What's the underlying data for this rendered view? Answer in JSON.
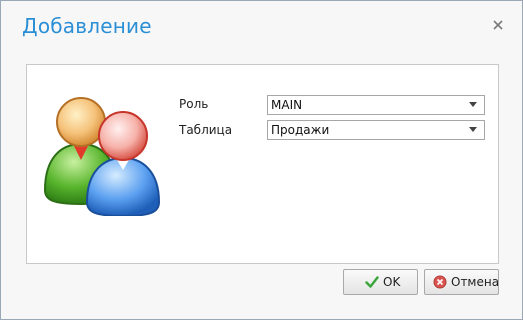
{
  "dialog": {
    "title": "Добавление",
    "close_glyph": "×"
  },
  "form": {
    "role_label": "Роль",
    "role_value": "MAIN",
    "table_label": "Таблица",
    "table_value": "Продажи"
  },
  "buttons": {
    "ok_label": "OK",
    "cancel_label": "Отмена"
  },
  "icons": {
    "users": "users-icon",
    "ok": "check-icon",
    "cancel": "cancel-icon",
    "close": "close-icon",
    "dropdown": "chevron-down-icon"
  },
  "colors": {
    "title": "#2b8fd6",
    "ok_check": "#3aa53a",
    "cancel_circle": "#d9534f"
  }
}
